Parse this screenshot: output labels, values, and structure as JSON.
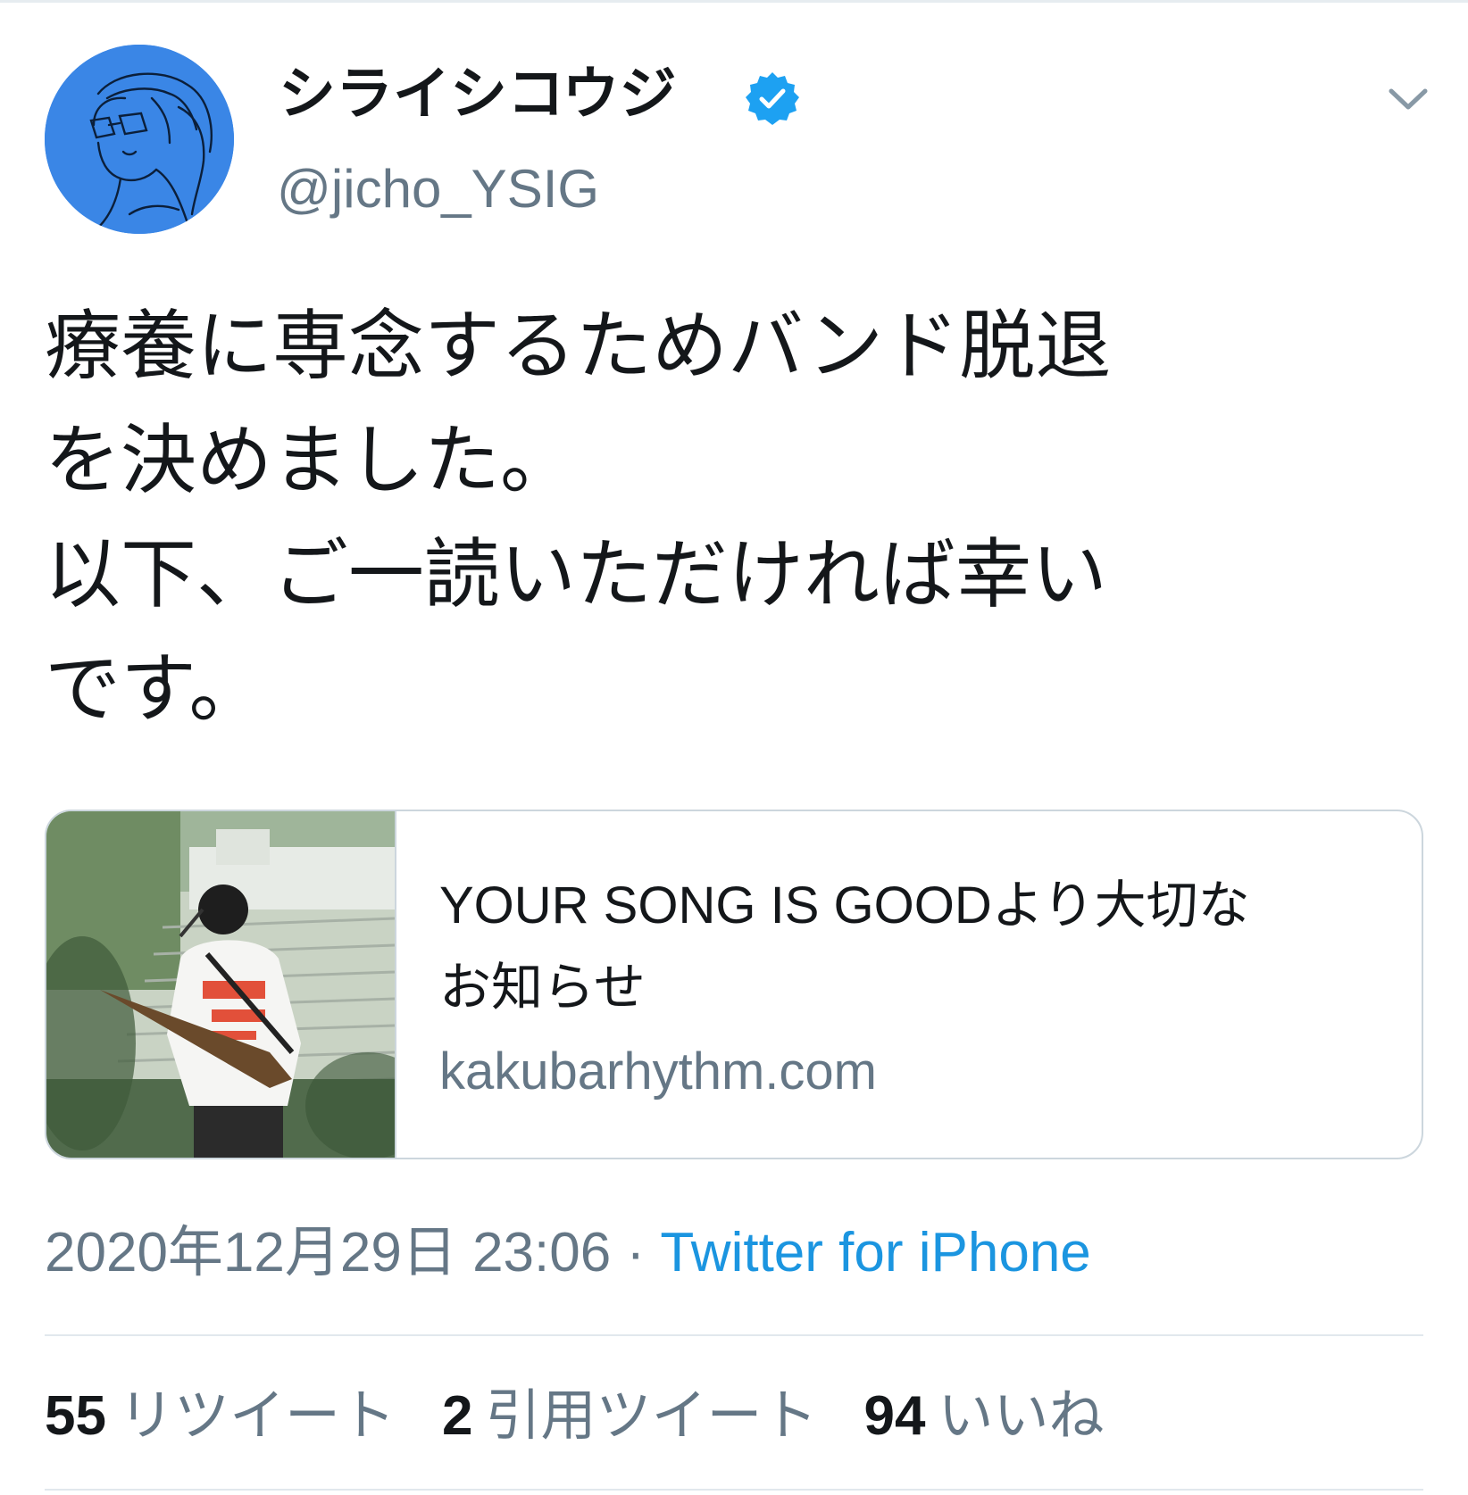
{
  "author": {
    "display_name": "シライシコウジ",
    "handle": "@jicho_YSIG",
    "verified": true,
    "avatar_icon": "avatar-sketch-portrait",
    "avatar_color": "#3a86e6"
  },
  "tweet": {
    "text_lines": [
      "療養に専念するためバンド脱退",
      "を決めました。",
      "以下、ご一読いただければ幸い",
      "です。"
    ]
  },
  "link_card": {
    "title_lines": [
      "YOUR SONG IS GOODより大切な",
      "お知らせ"
    ],
    "domain": "kakubarhythm.com",
    "thumbnail_icon": "guitarist-photo-thumbnail"
  },
  "meta": {
    "timestamp": "2020年12月29日 23:06",
    "separator": " · ",
    "source": "Twitter for iPhone"
  },
  "stats": {
    "retweets": {
      "count": "55",
      "label": "リツイート"
    },
    "quotes": {
      "count": "2",
      "label": "引用ツイート"
    },
    "likes": {
      "count": "94",
      "label": "いいね"
    }
  },
  "colors": {
    "text": "#14171a",
    "secondary": "#657786",
    "link": "#1b95e0",
    "verified": "#1da1f2",
    "border": "#ccd6dd"
  },
  "icons": {
    "verified": "verified-badge-icon",
    "menu": "chevron-down-icon"
  }
}
